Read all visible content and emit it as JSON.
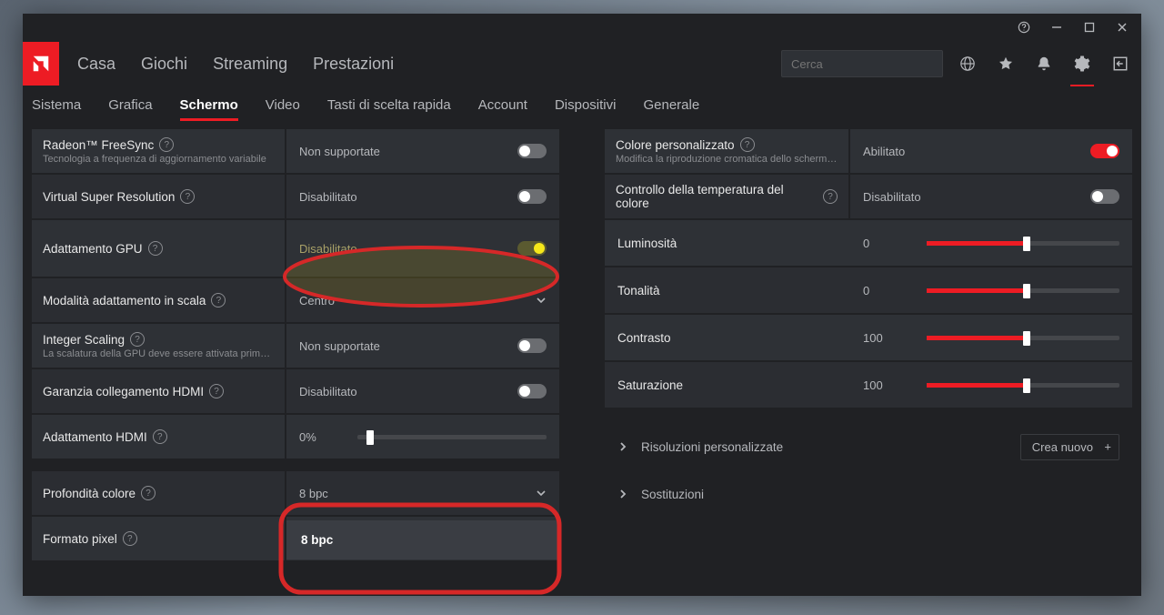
{
  "titlebar": {
    "help": "?",
    "min": "–",
    "max": "▢",
    "close": "×"
  },
  "nav": {
    "items": [
      "Casa",
      "Giochi",
      "Streaming",
      "Prestazioni"
    ]
  },
  "search": {
    "placeholder": "Cerca"
  },
  "header_icons": [
    "globe-icon",
    "star-icon",
    "bell-icon",
    "gear-icon",
    "exit-icon"
  ],
  "subtabs": [
    "Sistema",
    "Grafica",
    "Schermo",
    "Video",
    "Tasti di scelta rapida",
    "Account",
    "Dispositivi",
    "Generale"
  ],
  "subtab_active": "Schermo",
  "left": {
    "freesync": {
      "label": "Radeon™ FreeSync",
      "sub": "Tecnologia a frequenza di aggiornamento variabile",
      "value": "Non supportate"
    },
    "vsr": {
      "label": "Virtual Super Resolution",
      "value": "Disabilitato"
    },
    "gpu_scaling": {
      "label": "Adattamento GPU",
      "value": "Disabilitato"
    },
    "scaling_mode": {
      "label": "Modalità adattamento in scala",
      "value": "Centro"
    },
    "integer": {
      "label": "Integer Scaling",
      "sub": "La scalatura della GPU deve essere attivata prima ...",
      "value": "Non supportate"
    },
    "hdmi_link": {
      "label": "Garanzia collegamento HDMI",
      "value": "Disabilitato"
    },
    "hdmi_adapt": {
      "label": "Adattamento HDMI",
      "value": "0%",
      "pos": 5
    },
    "color_depth": {
      "label": "Profondità colore",
      "value": "8 bpc",
      "option": "8 bpc"
    },
    "pixel_format": {
      "label": "Formato pixel"
    }
  },
  "right": {
    "custom_color": {
      "label": "Colore personalizzato",
      "sub": "Modifica la riproduzione cromatica dello schermo's",
      "value": "Abilitato"
    },
    "color_temp": {
      "label": "Controllo della temperatura del colore",
      "value": "Disabilitato"
    },
    "sliders": [
      {
        "label": "Luminosità",
        "val": "0",
        "pos": 50
      },
      {
        "label": "Tonalità",
        "val": "0",
        "pos": 50
      },
      {
        "label": "Contrasto",
        "val": "100",
        "pos": 50
      },
      {
        "label": "Saturazione",
        "val": "100",
        "pos": 50
      }
    ],
    "custom_res": {
      "label": "Risoluzioni personalizzate",
      "button": "Crea nuovo"
    },
    "overrides": {
      "label": "Sostituzioni"
    }
  }
}
